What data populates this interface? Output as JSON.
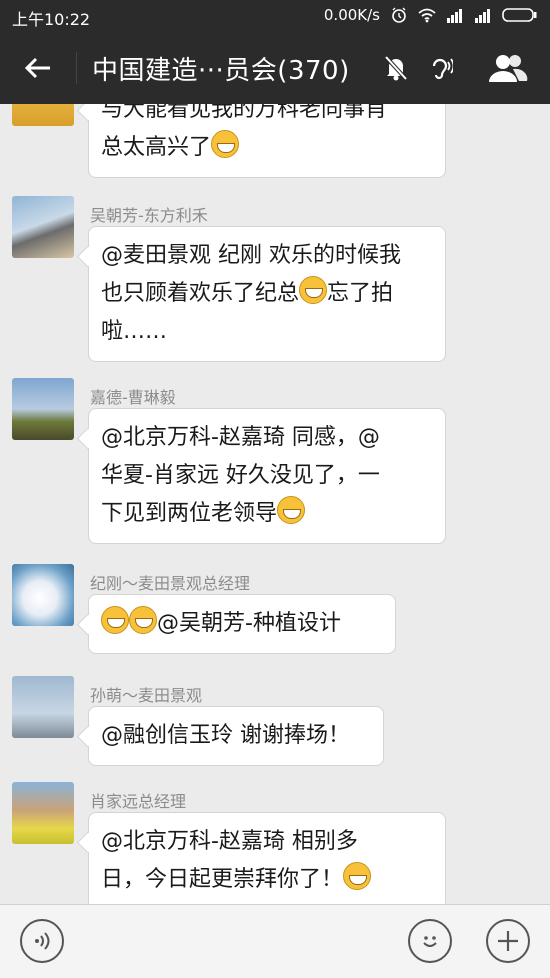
{
  "status_bar": {
    "time": "上午10:22",
    "network_speed": "0.00K/s"
  },
  "header": {
    "title": "中国建造···员会(370)"
  },
  "messages": [
    {
      "sender": "",
      "lines": [
        "与大能看见我的万科老同事肖",
        "总太高兴了"
      ],
      "emoji": "grin"
    },
    {
      "sender": "吴朝芳-东方利禾",
      "lines": [
        "@麦田景观 纪刚 欢乐的时候我",
        "也只顾着欢乐了纪总",
        "忘了拍",
        "啦……"
      ]
    },
    {
      "sender": "嘉德-曹琳毅",
      "lines": [
        "@北京万科-赵嘉琦 同感，@",
        "华夏-肖家远 好久没见了，一",
        "下见到两位老领导"
      ]
    },
    {
      "sender": "纪刚～麦田景观总经理",
      "lines": [
        "@吴朝芳-种植设计"
      ]
    },
    {
      "sender": "孙萌～麦田景观",
      "lines": [
        "@融创信玉玲 谢谢捧场！"
      ]
    },
    {
      "sender": "肖家远总经理",
      "lines": [
        "@北京万科-赵嘉琦 相别多",
        "日，今日起更崇拜你了！"
      ]
    }
  ],
  "colors": {
    "header_bg": "#2b2b2b",
    "chat_bg": "#ebebeb",
    "bubble_bg": "#ffffff",
    "sender_text": "#8c8c8c"
  }
}
